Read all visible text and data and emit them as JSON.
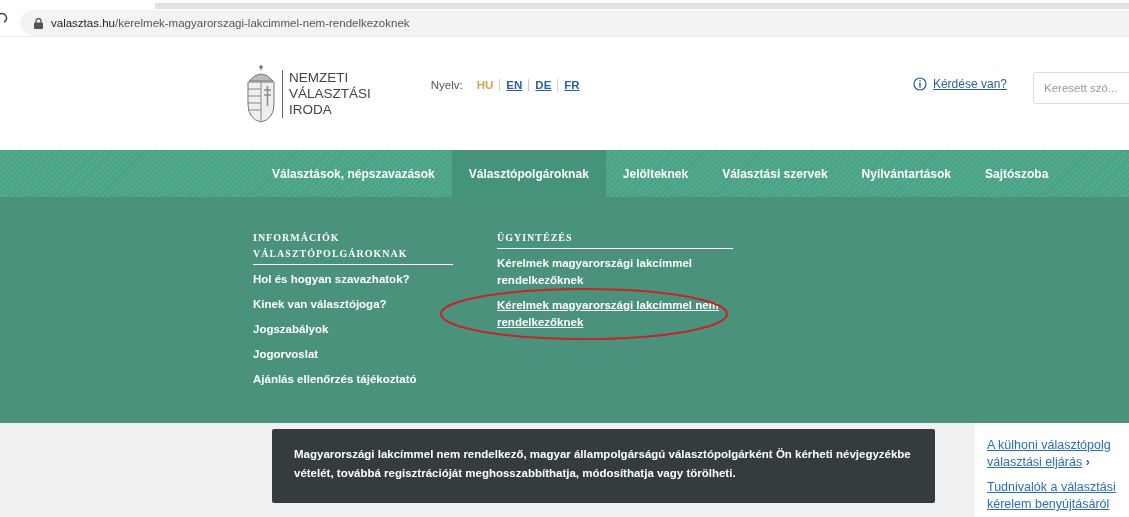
{
  "browser": {
    "url_host": "valasztas.hu",
    "url_path": "/kerelmek-magyarorszagi-lakcimmel-nem-rendelkezoknek"
  },
  "header": {
    "logo_lines": [
      "NEMZETI",
      "VÁLASZTÁSI",
      "IRODA"
    ],
    "language_label": "Nyelv:",
    "languages": [
      {
        "code": "HU",
        "selected": true
      },
      {
        "code": "EN",
        "selected": false
      },
      {
        "code": "DE",
        "selected": false
      },
      {
        "code": "FR",
        "selected": false
      }
    ],
    "help_link": "Kérdése van?",
    "search": {
      "placeholder": "Keresett szó..."
    }
  },
  "nav": [
    {
      "label": "Választások, népszavazások",
      "selected": false
    },
    {
      "label": "Választópolgároknak",
      "selected": true
    },
    {
      "label": "Jelölteknek",
      "selected": false
    },
    {
      "label": "Választási szervek",
      "selected": false
    },
    {
      "label": "Nyilvántartások",
      "selected": false
    },
    {
      "label": "Sajtószoba",
      "selected": false
    }
  ],
  "dropdown": {
    "columns": [
      {
        "heading": "INFORMÁCIÓK VÁLASZTÓPOLGÁROKNAK",
        "items": [
          {
            "label": "Hol és hogyan szavazhatok?",
            "selected": false
          },
          {
            "label": "Kinek van választójoga?",
            "selected": false
          },
          {
            "label": "Jogszabályok",
            "selected": false
          },
          {
            "label": "Jogorvoslat",
            "selected": false
          },
          {
            "label": "Ajánlás ellenőrzés tájékoztató",
            "selected": false
          }
        ]
      },
      {
        "heading": "ÜGYINTÉZÉS",
        "items": [
          {
            "label": "Kérelmek magyarországi lakcímmel rendelkezőknek",
            "selected": false
          },
          {
            "label": "Kérelmek magyarországi lakcímmel nem rendelkezőknek",
            "selected": true
          }
        ]
      }
    ]
  },
  "intro": "Magyarországi lakcímmel nem rendelkező, magyar állampolgárságú választópolgárként Ön kérheti névjegyzékbe vételét, továbbá regisztrációját meghosszabbíthatja, módosíthatja vagy törölheti.",
  "sidebar_links": [
    {
      "lines": [
        "A külhoni választópolg",
        "választási eljárás"
      ],
      "arrow": "›"
    },
    {
      "lines": [
        "Tudnivalók a választási",
        "kérelem benyújtásáról"
      ]
    }
  ]
}
